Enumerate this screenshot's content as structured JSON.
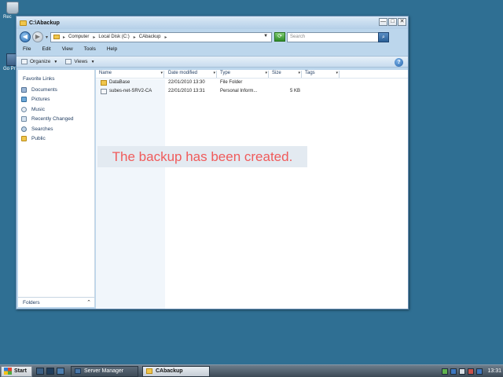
{
  "window": {
    "title": "C:\\Abackup",
    "minimize": "—",
    "maximize": "□",
    "close": "✕"
  },
  "address": {
    "breadcrumbs": [
      "Computer",
      "Local Disk (C:)",
      "CAbackup"
    ],
    "separator": "▸",
    "search_placeholder": "Search"
  },
  "menu": [
    "File",
    "Edit",
    "View",
    "Tools",
    "Help"
  ],
  "toolbar": {
    "organize": "Organize",
    "views": "Views",
    "help": "?"
  },
  "nav": {
    "header": "Favorite Links",
    "items": [
      "Documents",
      "Pictures",
      "Music",
      "Recently Changed",
      "Searches",
      "Public"
    ],
    "folders_label": "Folders"
  },
  "columns": [
    "Name",
    "Date modified",
    "Type",
    "Size",
    "Tags"
  ],
  "files": [
    {
      "name": "DataBase",
      "date": "22/01/2010 13:30",
      "type": "File Folder",
      "size": ""
    },
    {
      "name": "subes-net-SRV2-CA",
      "date": "22/01/2010 13:31",
      "type": "Personal Inform...",
      "size": "5 KB"
    }
  ],
  "overlay_message": "The backup has been created.",
  "desktop": {
    "recycle_label": "Rec",
    "printer_label": "Go Print"
  },
  "taskbar": {
    "start": "Start",
    "tasks": [
      "Server Manager",
      "CAbackup"
    ],
    "clock": "13:31"
  }
}
